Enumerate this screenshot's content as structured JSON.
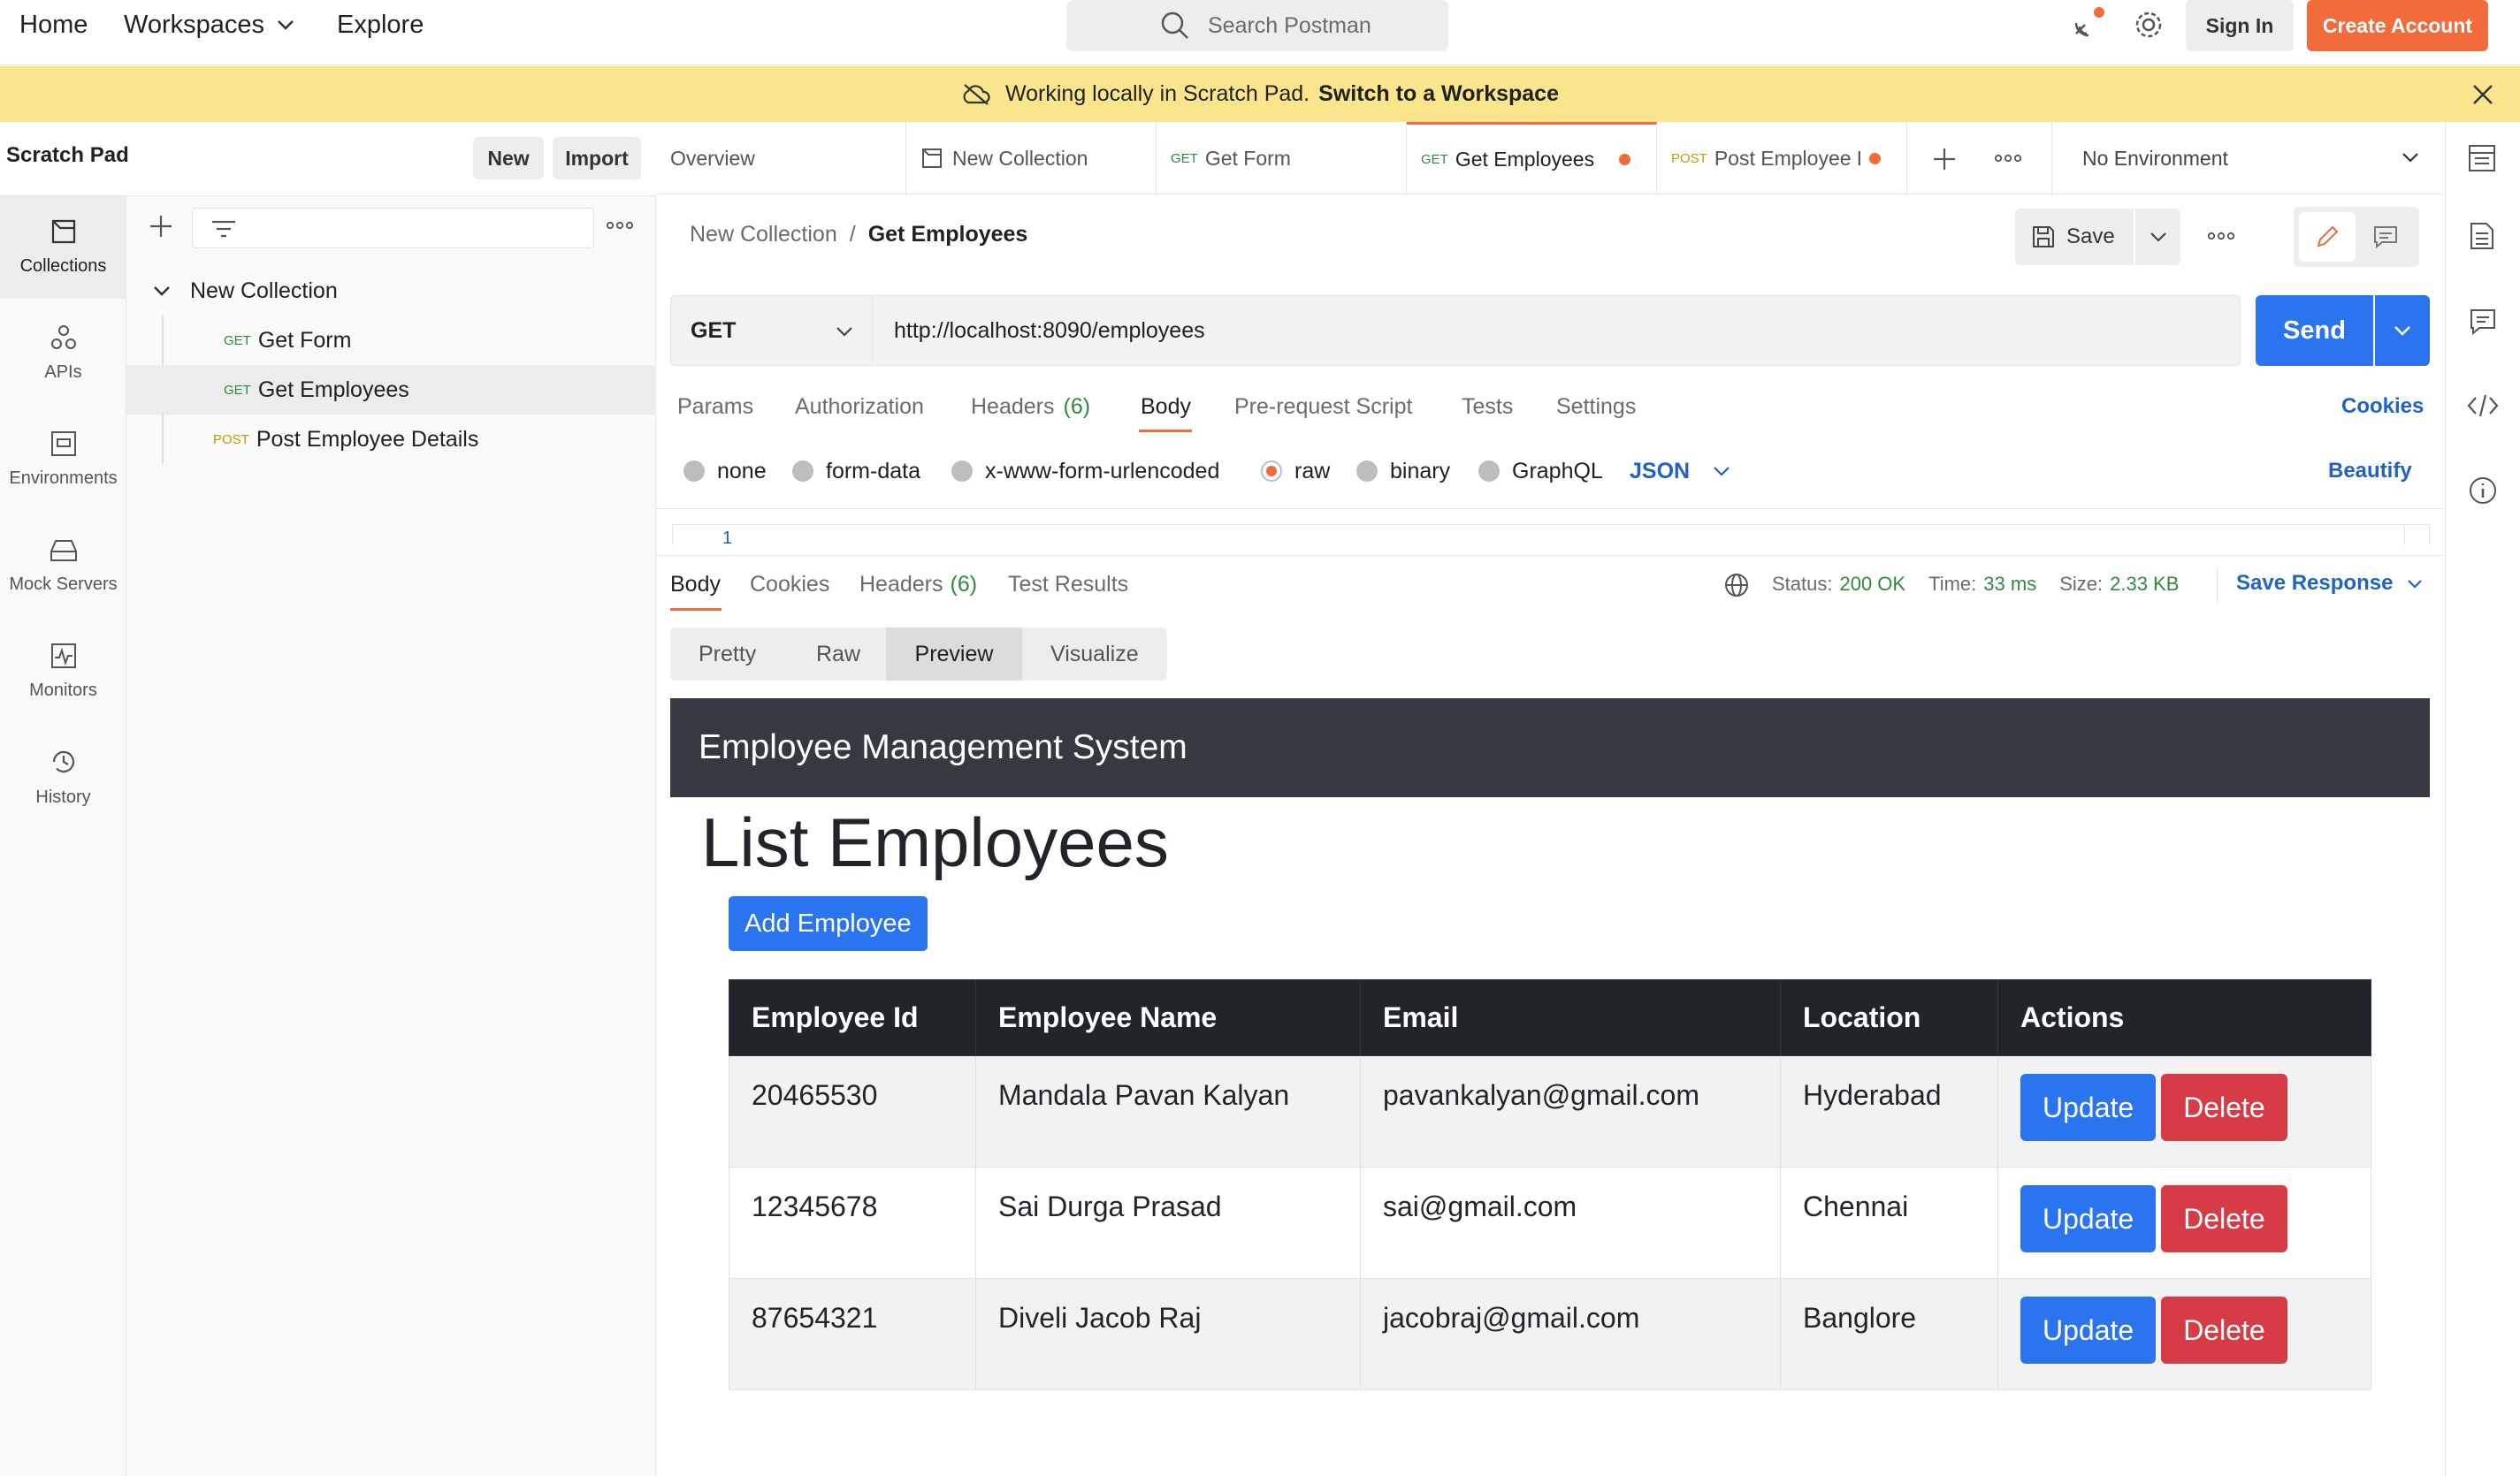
{
  "topbar": {
    "home": "Home",
    "workspaces": "Workspaces",
    "explore": "Explore",
    "search_placeholder": "Search Postman",
    "sign_in": "Sign In",
    "create_account": "Create Account"
  },
  "banner": {
    "text": "Working locally in Scratch Pad.",
    "link": "Switch to a Workspace"
  },
  "rail": {
    "items": [
      "Collections",
      "APIs",
      "Environments",
      "Mock Servers",
      "Monitors",
      "History"
    ]
  },
  "scratch": {
    "title": "Scratch Pad",
    "new_label": "New",
    "import_label": "Import"
  },
  "tree": {
    "collection": "New Collection",
    "requests": [
      {
        "method": "GET",
        "name": "Get Form"
      },
      {
        "method": "GET",
        "name": "Get Employees"
      },
      {
        "method": "POST",
        "name": "Post Employee Details"
      }
    ]
  },
  "tabs": [
    {
      "method": "",
      "label": "Overview"
    },
    {
      "method": "",
      "label": "New Collection"
    },
    {
      "method": "GET",
      "label": "Get Form"
    },
    {
      "method": "GET",
      "label": "Get Employees"
    },
    {
      "method": "POST",
      "label": "Post Employee D"
    }
  ],
  "environment": "No Environment",
  "request": {
    "breadcrumb_parent": "New Collection",
    "breadcrumb_sep": "/",
    "breadcrumb_current": "Get Employees",
    "save_label": "Save",
    "method": "GET",
    "url": "http://localhost:8090/employees",
    "send_label": "Send"
  },
  "req_tabs": {
    "params": "Params",
    "authorization": "Authorization",
    "headers": "Headers",
    "headers_count": "(6)",
    "body": "Body",
    "prerequest": "Pre-request Script",
    "tests": "Tests",
    "settings": "Settings",
    "cookies": "Cookies"
  },
  "body_types": {
    "none": "none",
    "form_data": "form-data",
    "urlencoded": "x-www-form-urlencoded",
    "raw": "raw",
    "binary": "binary",
    "graphql": "GraphQL",
    "format": "JSON",
    "beautify": "Beautify",
    "line_no": "1"
  },
  "response": {
    "tabs": {
      "body": "Body",
      "cookies": "Cookies",
      "headers": "Headers",
      "headers_count": "(6)",
      "test_results": "Test Results"
    },
    "status_label": "Status:",
    "status_value": "200 OK",
    "time_label": "Time:",
    "time_value": "33 ms",
    "size_label": "Size:",
    "size_value": "2.33 KB",
    "save_response": "Save Response",
    "views": [
      "Pretty",
      "Raw",
      "Preview",
      "Visualize"
    ]
  },
  "preview": {
    "navbar_title": "Employee Management System",
    "heading": "List Employees",
    "add_button": "Add Employee",
    "columns": [
      "Employee Id",
      "Employee Name",
      "Email",
      "Location",
      "Actions"
    ],
    "rows": [
      [
        "20465530",
        "Mandala Pavan Kalyan",
        "pavankalyan@gmail.com",
        "Hyderabad"
      ],
      [
        "12345678",
        "Sai Durga Prasad",
        "sai@gmail.com",
        "Chennai"
      ],
      [
        "87654321",
        "Diveli Jacob Raj",
        "jacobraj@gmail.com",
        "Banglore"
      ]
    ],
    "update_label": "Update",
    "delete_label": "Delete"
  },
  "colors": {
    "accent": "#f26b3a",
    "send_blue": "#2a74f0",
    "banner": "#f9e58c",
    "link_blue": "#1f63c5"
  }
}
